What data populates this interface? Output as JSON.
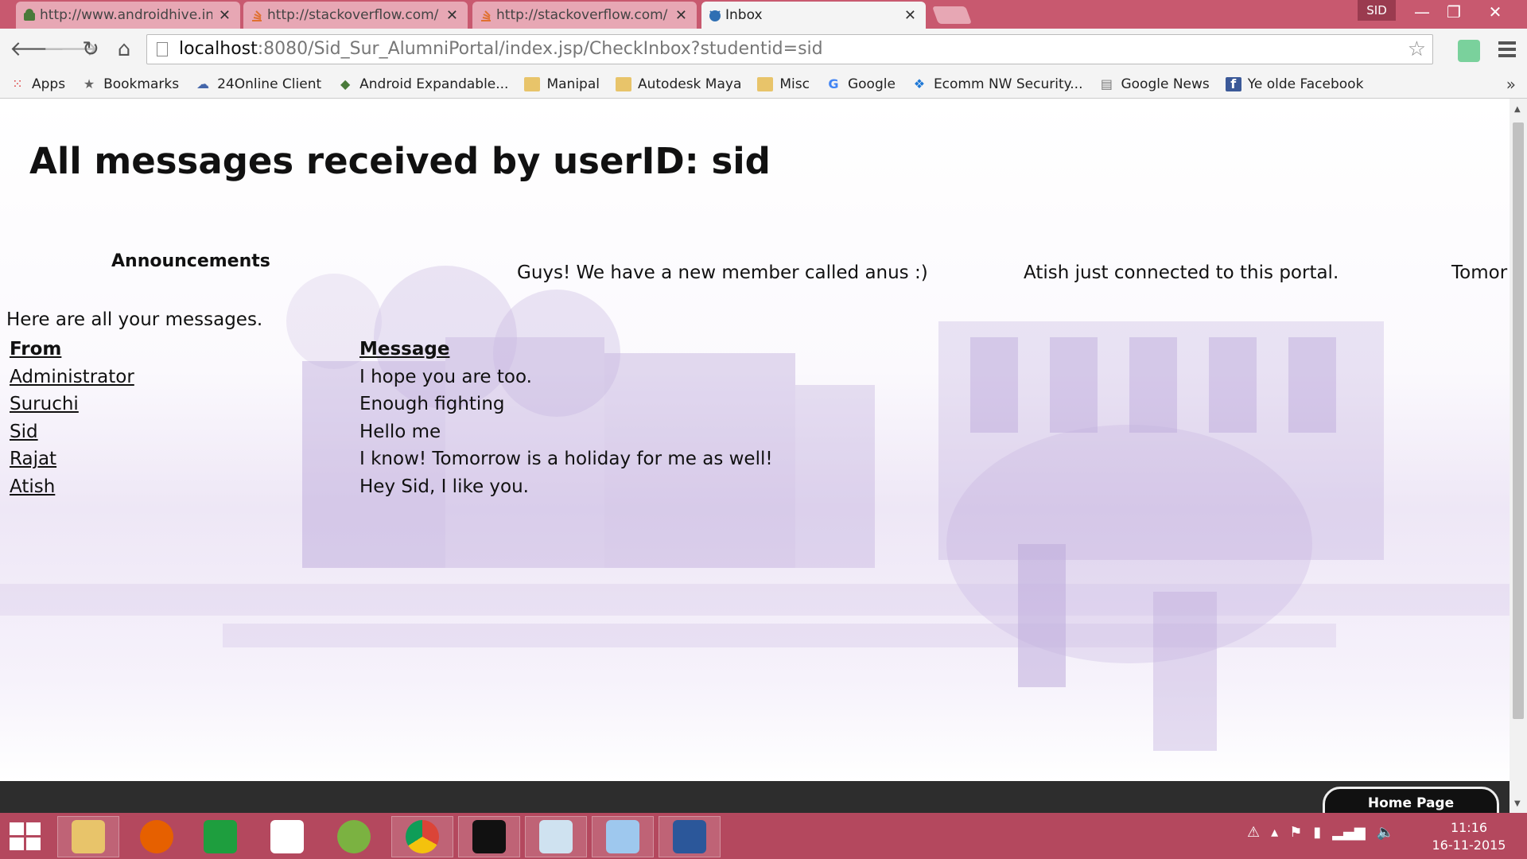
{
  "browser": {
    "tabs": [
      {
        "title": "http://www.androidhive.in",
        "active": false
      },
      {
        "title": "http://stackoverflow.com/",
        "active": false
      },
      {
        "title": "http://stackoverflow.com/",
        "active": false
      },
      {
        "title": "Inbox",
        "active": true
      }
    ],
    "profile": "SID",
    "url_host": "localhost",
    "url_path": ":8080/Sid_Sur_AlumniPortal/index.jsp/CheckInbox?studentid=sid",
    "bookmarks": [
      {
        "label": "Apps",
        "icon": "apps-grid-icon"
      },
      {
        "label": "Bookmarks",
        "icon": "star-icon"
      },
      {
        "label": "24Online Client",
        "icon": "cloud-icon"
      },
      {
        "label": "Android Expandable...",
        "icon": "android-icon"
      },
      {
        "label": "Manipal",
        "icon": "folder-icon"
      },
      {
        "label": "Autodesk Maya",
        "icon": "folder-icon"
      },
      {
        "label": "Misc",
        "icon": "folder-icon"
      },
      {
        "label": "Google",
        "icon": "google-icon"
      },
      {
        "label": "Ecomm NW Security...",
        "icon": "dropbox-icon"
      },
      {
        "label": "Google News",
        "icon": "news-icon"
      },
      {
        "label": "Ye olde Facebook",
        "icon": "facebook-icon"
      }
    ],
    "bookmarks_more": "»"
  },
  "page": {
    "title": "All messages received by userID: sid",
    "announcements_label": "Announcements",
    "announcements": [
      "Guys! We have a new member called anus :)",
      "Atish just connected to this portal.",
      "Tomor"
    ],
    "intro": "Here are all your messages.",
    "table": {
      "col_from": "From",
      "col_message": "Message",
      "rows": [
        {
          "from": "Administrator",
          "message": "I hope you are too."
        },
        {
          "from": "Suruchi",
          "message": "Enough fighting"
        },
        {
          "from": "Sid",
          "message": "Hello me"
        },
        {
          "from": "Rajat",
          "message": "I know! Tomorrow is a holiday for me as well!"
        },
        {
          "from": "Atish",
          "message": "Hey Sid, I like you."
        }
      ]
    },
    "home_button": "Home Page"
  },
  "taskbar": {
    "apps": [
      "file-explorer-icon",
      "firefox-icon",
      "store-icon",
      "dropbox-icon",
      "utorrent-icon",
      "chrome-icon",
      "cmd-icon",
      "window-icon",
      "virtualbox-icon",
      "word-icon"
    ],
    "time": "11:16",
    "date": "16-11-2015"
  },
  "colors": {
    "tabstrip": "#c8596f",
    "taskbar": "#b4485e",
    "background_tint": "#9b7fc8"
  }
}
